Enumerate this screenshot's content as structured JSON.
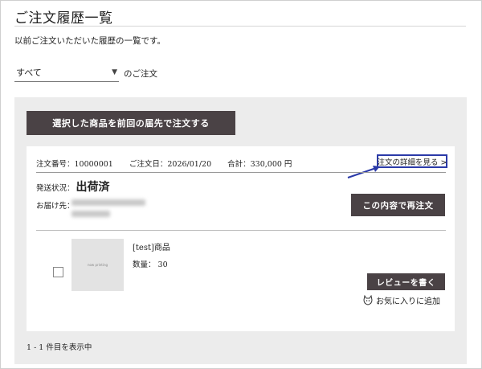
{
  "page": {
    "title": "ご注文履歴一覧",
    "subtitle": "以前ご注文いただいた履歴の一覧です。"
  },
  "filter": {
    "selected": "すべて",
    "suffix": "のご注文"
  },
  "toolbar": {
    "reorder_selected_label": "選択した商品を前回の届先で注文する"
  },
  "order": {
    "number_label": "注文番号：10000001",
    "date_label": "ご注文日：2026/01/20",
    "total_label": "合計：330,000 円",
    "detail_link_label": "注文の詳細を見る >",
    "status_label": "発送状況：",
    "status_value": "出荷済",
    "ship_to_label": "お届け先：",
    "reorder_label": "この内容で再注文"
  },
  "item": {
    "thumb_text": "now printing",
    "name": "[test]商品",
    "qty": "数量： 30",
    "review_label": "レビューを書く",
    "favorite_label": "お気に入りに追加"
  },
  "footer": {
    "count": "1 - 1 件目を表示中"
  },
  "colors": {
    "button_bg": "#4a4245",
    "panel_bg": "#ececec",
    "annotation_blue": "#2b3aa8"
  },
  "icons": [
    "chevron-down-icon",
    "arrow-annotation-icon",
    "heart-outline-icon"
  ]
}
